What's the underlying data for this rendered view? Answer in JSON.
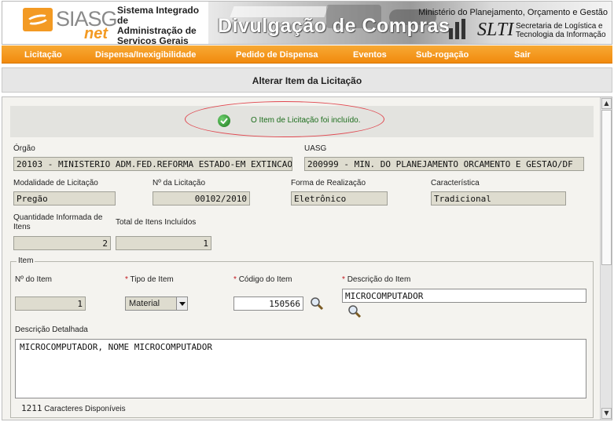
{
  "header": {
    "logo_main": "SIASG",
    "logo_sub": "net",
    "system_name_line1": "Sistema Integrado de",
    "system_name_line2": "Administração de",
    "system_name_line3": "Serviços Gerais",
    "banner_title": "Divulgação de Compras",
    "ministry": "Ministério do Planejamento, Orçamento e Gestão",
    "slti_logo": "SLTI",
    "slti_line1": "Secretaria de Logística e",
    "slti_line2": "Tecnologia da Informação"
  },
  "menu": [
    {
      "label": "Licitação"
    },
    {
      "label": "Dispensa/Inexigibilidade"
    },
    {
      "label": "Pedido de Dispensa"
    },
    {
      "label": "Eventos"
    },
    {
      "label": "Sub-rogação"
    },
    {
      "label": "Sair"
    }
  ],
  "page": {
    "title": "Alterar Item da Licitação"
  },
  "message": {
    "text": "O Item de Licitação foi incluído.",
    "icon": "check-circle-icon"
  },
  "form": {
    "orgao_label": "Órgão",
    "orgao_value": "20103 - MINISTERIO ADM.FED.REFORMA ESTADO-EM EXTINCAO",
    "uasg_label": "UASG",
    "uasg_value": "200999 - MIN. DO PLANEJAMENTO ORCAMENTO E GESTAO/DF",
    "modalidade_label": "Modalidade de Licitação",
    "modalidade_value": "Pregão",
    "numero_label": "Nº da Licitação",
    "numero_value": "00102/2010",
    "forma_label": "Forma de Realização",
    "forma_value": "Eletrônico",
    "caracteristica_label": "Característica",
    "caracteristica_value": "Tradicional",
    "qtd_label_line1": "Quantidade Informada de",
    "qtd_label_line2": "Itens",
    "qtd_value": "2",
    "total_label": "Total de Itens Incluídos",
    "total_value": "1"
  },
  "item": {
    "legend": "Item",
    "numero_label": "Nº do Item",
    "numero_value": "1",
    "required_mark": "*",
    "tipo_label": "Tipo de Item",
    "tipo_value": "Material",
    "codigo_label": "Código do Item",
    "codigo_value": "150566",
    "descricao_label": "Descrição do Item",
    "descricao_value": "MICROCOMPUTADOR",
    "detalhada_label": "Descrição Detalhada",
    "detalhada_value": "MICROCOMPUTADOR, NOME MICROCOMPUTADOR",
    "caracteres_count": "1211",
    "caracteres_label": "Caracteres Disponíveis"
  },
  "colors": {
    "menu_orange": "#f18a0e",
    "success_green": "#1c6d1c",
    "required_red": "#c0151c",
    "readonly_bg": "#dedccf"
  }
}
